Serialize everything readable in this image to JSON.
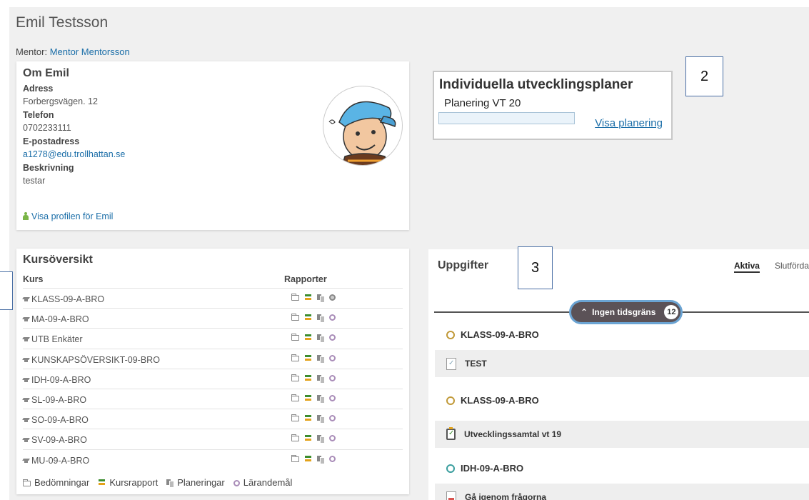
{
  "student": {
    "name": "Emil Testsson",
    "mentor_label": "Mentor:",
    "mentor_name": "Mentor Mentorsson"
  },
  "about": {
    "title": "Om Emil",
    "address_label": "Adress",
    "address": "Forbergsvägen. 12",
    "phone_label": "Telefon",
    "phone": "0702233111",
    "email_label": "E-postadress",
    "email": "a1278@edu.trollhattan.se",
    "description_label": "Beskrivning",
    "description": "testar",
    "profile_link": "Visa profilen för Emil"
  },
  "iup": {
    "title": "Individuella utvecklingsplaner",
    "plan_name": "Planering VT 20",
    "progress": 0,
    "show_plan": "Visa planering"
  },
  "callouts": {
    "two": "2",
    "three": "3"
  },
  "courses": {
    "title": "Kursöversikt",
    "col_course": "Kurs",
    "col_reports": "Rapporter",
    "items": [
      "KLASS-09-A-BRO",
      "MA-09-A-BRO",
      "UTB Enkäter",
      "KUNSKAPSÖVERSIKT-09-BRO",
      "IDH-09-A-BRO",
      "SL-09-A-BRO",
      "SO-09-A-BRO",
      "SV-09-A-BRO",
      "MU-09-A-BRO"
    ],
    "legend": {
      "assessments": "Bedömningar",
      "course_report": "Kursrapport",
      "plannings": "Planeringar",
      "learning_goals": "Lärandemål"
    }
  },
  "tasks": {
    "title": "Uppgifter",
    "tab_active": "Aktiva",
    "tab_done": "Slutförda",
    "filter_label": "Ingen tidsgräns",
    "filter_count": "12",
    "groups": [
      {
        "name": "KLASS-09-A-BRO",
        "task": "TEST"
      },
      {
        "name": "KLASS-09-A-BRO",
        "task": "Utvecklingssamtal vt 19"
      },
      {
        "name": "IDH-09-A-BRO",
        "task": "Gå igenom frågorna"
      }
    ]
  },
  "colors": {
    "link": "#1b6ea8",
    "pill_bg": "#5b5257",
    "pill_border": "#6ba4d3"
  }
}
